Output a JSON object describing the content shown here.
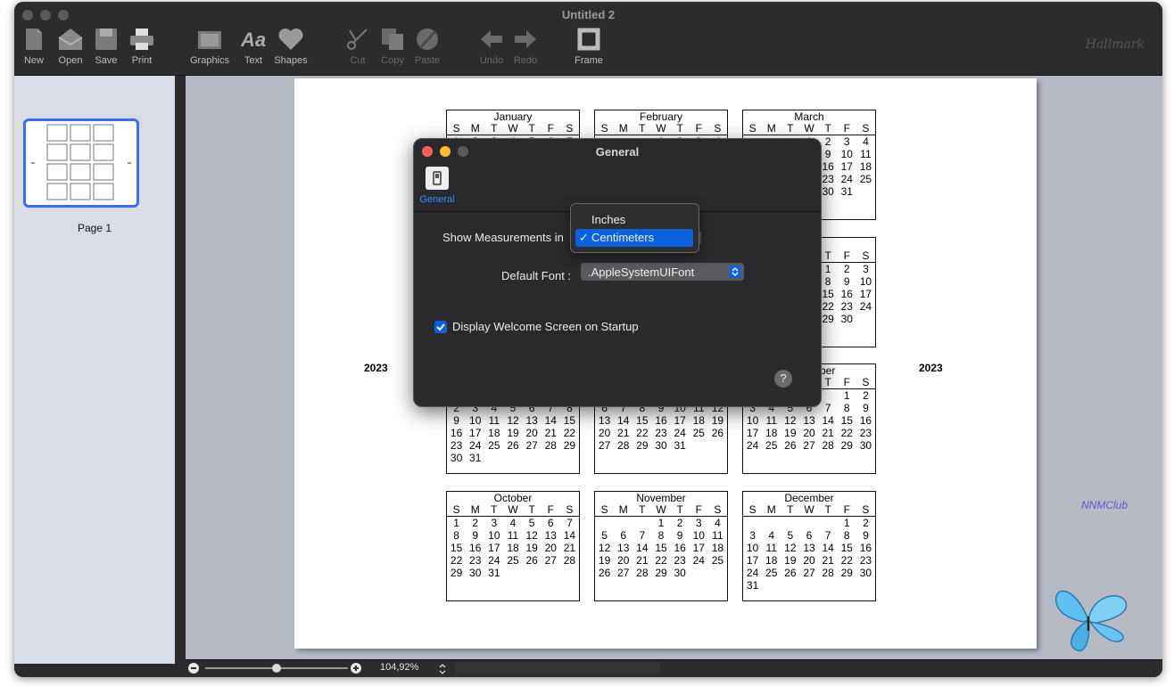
{
  "window": {
    "title": "Untitled 2"
  },
  "toolbar": {
    "items": [
      {
        "label": "New",
        "icon": "new-icon"
      },
      {
        "label": "Open",
        "icon": "open-icon"
      },
      {
        "label": "Save",
        "icon": "save-icon"
      },
      {
        "label": "Print",
        "icon": "print-icon"
      },
      {
        "label": "Graphics",
        "icon": "graphics-icon"
      },
      {
        "label": "Text",
        "icon": "text-icon"
      },
      {
        "label": "Shapes",
        "icon": "shapes-icon"
      },
      {
        "label": "Cut",
        "icon": "cut-icon"
      },
      {
        "label": "Copy",
        "icon": "copy-icon"
      },
      {
        "label": "Paste",
        "icon": "paste-icon"
      },
      {
        "label": "Undo",
        "icon": "undo-icon"
      },
      {
        "label": "Redo",
        "icon": "redo-icon"
      },
      {
        "label": "Frame",
        "icon": "frame-icon"
      }
    ],
    "brand": "Hallmark"
  },
  "sidebar": {
    "page_label": "Page 1"
  },
  "calendar": {
    "year_left": "2023",
    "year_right": "2023",
    "dow": [
      "S",
      "M",
      "T",
      "W",
      "T",
      "F",
      "S"
    ],
    "months": [
      {
        "name": "January",
        "offset": 0,
        "days": 31
      },
      {
        "name": "February",
        "offset": 3,
        "days": 28
      },
      {
        "name": "March",
        "offset": 3,
        "days": 31
      },
      {
        "name": "April",
        "offset": 6,
        "days": 30
      },
      {
        "name": "May",
        "offset": 1,
        "days": 31
      },
      {
        "name": "June",
        "offset": 4,
        "days": 30
      },
      {
        "name": "July",
        "offset": 6,
        "days": 31
      },
      {
        "name": "August",
        "offset": 2,
        "days": 31
      },
      {
        "name": "September",
        "offset": 5,
        "days": 30
      },
      {
        "name": "October",
        "offset": 0,
        "days": 31
      },
      {
        "name": "November",
        "offset": 3,
        "days": 30
      },
      {
        "name": "December",
        "offset": 5,
        "days": 31
      }
    ]
  },
  "dialog": {
    "title": "General",
    "tab_label": "General",
    "measure_label": "Show Measurements in",
    "measure_options": [
      "Inches",
      "Centimeters"
    ],
    "measure_selected": "Centimeters",
    "checkmark": "✓",
    "font_label": "Default Font :",
    "font_value": ".AppleSystemUIFont",
    "welcome_label": "Display Welcome Screen on Startup",
    "welcome_checked": true,
    "help": "?"
  },
  "status": {
    "zoom": "104,92%",
    "zoom_fraction": 0.5
  },
  "watermark": {
    "text": "NNMClub"
  },
  "colors": {
    "accent": "#0a62e0",
    "selection": "#3a6dff",
    "close": "#ff5f57",
    "minimize": "#febc2e",
    "zoom": "#5a5a5c"
  }
}
